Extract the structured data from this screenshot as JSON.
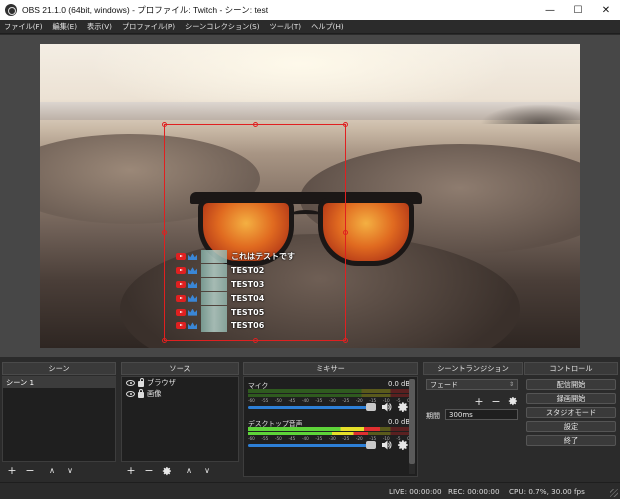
{
  "window": {
    "title": "OBS 21.1.0 (64bit, windows) - プロファイル: Twitch - シーン: test",
    "minimize": "—",
    "maximize": "☐",
    "close": "✕"
  },
  "menu": [
    "ファイル(F)",
    "編集(E)",
    "表示(V)",
    "プロファイル(P)",
    "シーンコレクション(S)",
    "ツール(T)",
    "ヘルプ(H)"
  ],
  "overlay": {
    "messages": [
      "これはテストです",
      "TEST02",
      "TEST03",
      "TEST04",
      "TEST05",
      "TEST06"
    ]
  },
  "docks": {
    "scenes": {
      "title": "シーン",
      "items": [
        "シーン 1"
      ]
    },
    "sources": {
      "title": "ソース",
      "items": [
        "ブラウザ",
        "画像"
      ]
    },
    "mixer": {
      "title": "ミキサー",
      "tracks": [
        {
          "name": "マイク",
          "db": "0.0 dB"
        },
        {
          "name": "デスクトップ音声",
          "db": "0.0 dB"
        }
      ],
      "ticks": [
        "-60",
        "-55",
        "-50",
        "-45",
        "-40",
        "-35",
        "-30",
        "-25",
        "-20",
        "-15",
        "-10",
        "-5",
        "0"
      ]
    },
    "transitions": {
      "title": "シーントランジション",
      "selected": "フェード",
      "duration_label": "期間",
      "duration": "300ms"
    },
    "controls": {
      "title": "コントロール",
      "buttons": [
        "配信開始",
        "録画開始",
        "スタジオモード",
        "設定",
        "終了"
      ]
    }
  },
  "toolbar": {
    "add": "+",
    "remove": "−",
    "up": "∧",
    "down": "∨"
  },
  "status": {
    "live": "LIVE: 00:00:00",
    "rec": "REC: 00:00:00",
    "cpu": "CPU: 0.7%, 30.00 fps"
  },
  "colors": {
    "selection": "#e02020",
    "slider": "#2d7fd6",
    "meter_green": "#5ed43a",
    "meter_yellow": "#e6e02a",
    "meter_red": "#e03030"
  }
}
